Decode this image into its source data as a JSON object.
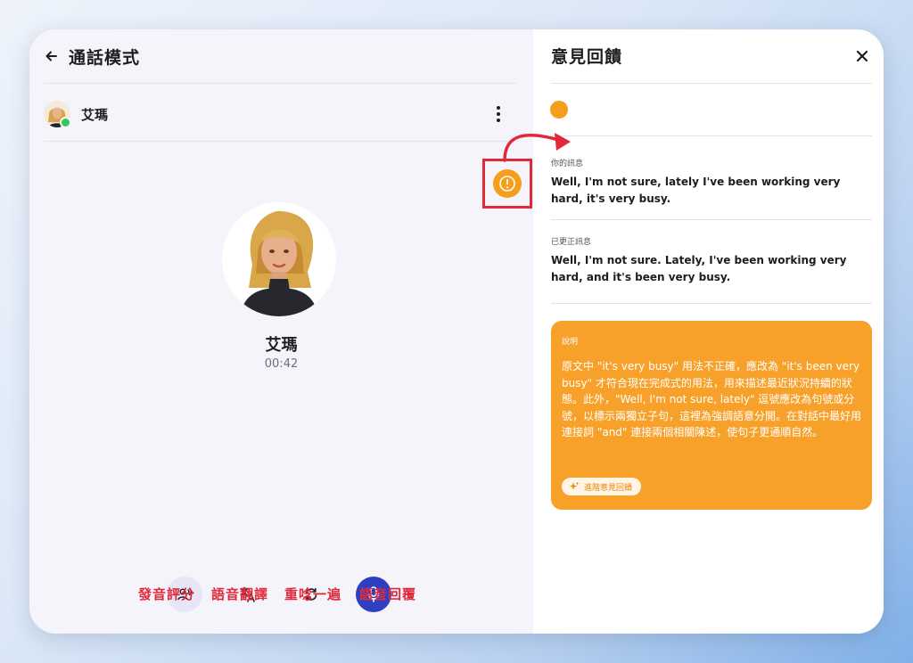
{
  "call_screen": {
    "header_title": "通話模式",
    "contact_name": "艾瑪",
    "character_name": "艾瑪",
    "call_timer": "00:42",
    "toolbar": {
      "pronunciation_label": "發音評分",
      "translation_label": "語音翻譯",
      "repeat_label": "重唸一遍",
      "voice_reply_label": "語音回覆"
    }
  },
  "feedback_panel": {
    "title": "意見回饋",
    "your_message_label": "你的訊息",
    "your_message": "Well, I'm not sure, lately I've been working very hard, it's very busy.",
    "corrected_label": "已更正訊息",
    "corrected_message": "Well, I'm not sure. Lately, I've been working very hard, and it's been very busy.",
    "explanation_label": "說明",
    "explanation_text": "原文中 \"it's very busy\" 用法不正確，應改為 \"it's been very busy\" 才符合現在完成式的用法，用來描述最近狀況持續的狀態。此外，\"Well, I'm not sure, lately\" 逗號應改為句號或分號，以標示兩獨立子句，這裡為強調語意分開。在對話中最好用連接詞 \"and\" 連接兩個相關陳述，使句子更通順自然。",
    "advanced_feedback_button": "進階意見回饋"
  },
  "colors": {
    "accent_orange": "#f8a12a",
    "alert_orange": "#f59e1b",
    "annotation_red": "#e02a3b",
    "mic_blue": "#2f3fc4",
    "online_green": "#34c759"
  },
  "icons": [
    "back-arrow-icon",
    "more-vertical-icon",
    "alert-icon",
    "pronunciation-icon",
    "translate-icon",
    "repeat-icon",
    "microphone-icon",
    "close-icon",
    "sparkle-icon"
  ]
}
